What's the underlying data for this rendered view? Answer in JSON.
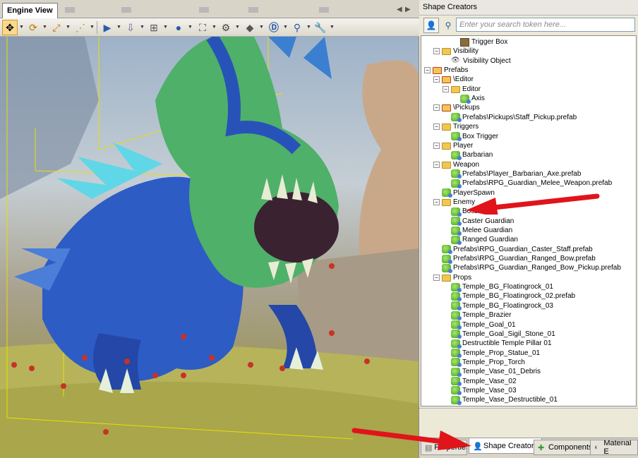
{
  "engine_view": {
    "tab_label": "Engine View",
    "toolbar_icons": [
      "move-tool-icon",
      "rotate-tool-icon",
      "scale-tool-icon",
      "link-tool-icon",
      "play-icon",
      "drop-to-floor-icon",
      "snap-icon",
      "sphere-icon",
      "camera-icon",
      "camera-settings-icon",
      "shading-icon",
      "debug-d-icon",
      "zoom-icon",
      "wrench-icon"
    ]
  },
  "shape_creators": {
    "title": "Shape Creators",
    "search_placeholder": "Enter your search token here...",
    "tree": [
      {
        "label": "Trigger Box",
        "level": 3,
        "icon": "trigger-box-icon"
      },
      {
        "label": "Visibility",
        "level": 1,
        "icon": "folder-icon",
        "toggle": "−"
      },
      {
        "label": "Visibility Object",
        "level": 2,
        "icon": "eye-icon"
      },
      {
        "label": "Prefabs",
        "level": 0,
        "icon": "prefab-folder-icon",
        "toggle": "−"
      },
      {
        "label": "\\Editor",
        "level": 1,
        "icon": "prefab-folder-icon",
        "toggle": "−"
      },
      {
        "label": "Editor",
        "level": 2,
        "icon": "folder-icon",
        "toggle": "−"
      },
      {
        "label": "Axis",
        "level": 3,
        "icon": "shape-icon"
      },
      {
        "label": "\\Pickups",
        "level": 1,
        "icon": "prefab-folder-icon",
        "toggle": "−"
      },
      {
        "label": "Prefabs\\Pickups\\Staff_Pickup.prefab",
        "level": 2,
        "icon": "shape-icon"
      },
      {
        "label": "Triggers",
        "level": 1,
        "icon": "folder-icon",
        "toggle": "−"
      },
      {
        "label": "Box Trigger",
        "level": 2,
        "icon": "shape-icon"
      },
      {
        "label": "Player",
        "level": 1,
        "icon": "folder-icon",
        "toggle": "−"
      },
      {
        "label": "Barbarian",
        "level": 2,
        "icon": "shape-icon"
      },
      {
        "label": "Weapon",
        "level": 1,
        "icon": "folder-icon",
        "toggle": "−"
      },
      {
        "label": "Prefabs\\Player_Barbarian_Axe.prefab",
        "level": 2,
        "icon": "shape-icon"
      },
      {
        "label": "Prefabs\\RPG_Guardian_Melee_Weapon.prefab",
        "level": 2,
        "icon": "shape-icon"
      },
      {
        "label": "PlayerSpawn",
        "level": 1,
        "icon": "shape-icon"
      },
      {
        "label": "Enemy",
        "level": 1,
        "icon": "folder-icon",
        "toggle": "−"
      },
      {
        "label": "Boss",
        "level": 2,
        "icon": "shape-icon"
      },
      {
        "label": "Caster Guardian",
        "level": 2,
        "icon": "shape-icon"
      },
      {
        "label": "Melee Guardian",
        "level": 2,
        "icon": "shape-icon"
      },
      {
        "label": "Ranged Guardian",
        "level": 2,
        "icon": "shape-icon"
      },
      {
        "label": "Prefabs\\RPG_Guardian_Caster_Staff.prefab",
        "level": 1,
        "icon": "shape-icon"
      },
      {
        "label": "Prefabs\\RPG_Guardian_Ranged_Bow.prefab",
        "level": 1,
        "icon": "shape-icon"
      },
      {
        "label": "Prefabs\\RPG_Guardian_Ranged_Bow_Pickup.prefab",
        "level": 1,
        "icon": "shape-icon"
      },
      {
        "label": "Props",
        "level": 1,
        "icon": "folder-icon",
        "toggle": "−"
      },
      {
        "label": "Temple_BG_Floatingrock_01",
        "level": 2,
        "icon": "shape-icon"
      },
      {
        "label": "Temple_BG_Floatingrock_02.prefab",
        "level": 2,
        "icon": "shape-icon"
      },
      {
        "label": "Temple_BG_Floatingrock_03",
        "level": 2,
        "icon": "shape-icon"
      },
      {
        "label": "Temple_Brazier",
        "level": 2,
        "icon": "shape-icon"
      },
      {
        "label": "Temple_Goal_01",
        "level": 2,
        "icon": "shape-icon"
      },
      {
        "label": "Temple_Goal_Sigil_Stone_01",
        "level": 2,
        "icon": "shape-icon"
      },
      {
        "label": "Destructible Temple Pillar 01",
        "level": 2,
        "icon": "shape-icon"
      },
      {
        "label": "Temple_Prop_Statue_01",
        "level": 2,
        "icon": "shape-icon"
      },
      {
        "label": "Temple_Prop_Torch",
        "level": 2,
        "icon": "shape-icon"
      },
      {
        "label": "Temple_Vase_01_Debris",
        "level": 2,
        "icon": "shape-icon"
      },
      {
        "label": "Temple_Vase_02",
        "level": 2,
        "icon": "shape-icon"
      },
      {
        "label": "Temple_Vase_03",
        "level": 2,
        "icon": "shape-icon"
      },
      {
        "label": "Temple_Vase_Destructible_01",
        "level": 2,
        "icon": "shape-icon"
      }
    ]
  },
  "bottom_tabs": {
    "properties": "Properties",
    "shape_creators": "Shape Creators",
    "components": "Components",
    "material_editor": "Material E"
  }
}
